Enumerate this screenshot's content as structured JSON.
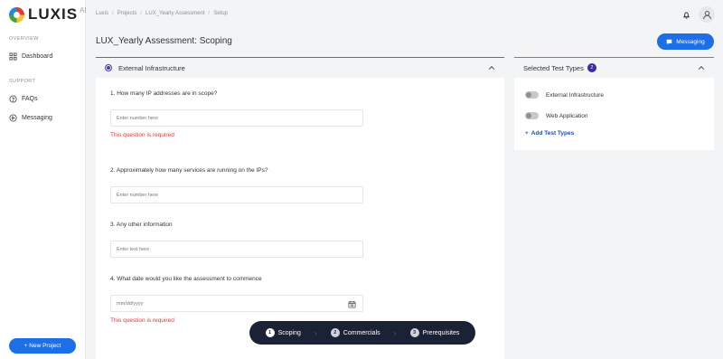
{
  "logo": {
    "text": "LUXIS",
    "suffix": "AI"
  },
  "sidebar": {
    "overview_label": "OVERVIEW",
    "support_label": "SUPPORT",
    "items": [
      {
        "label": "Dashboard",
        "icon": "grid-icon"
      },
      {
        "label": "FAQs",
        "icon": "help-circle-icon"
      },
      {
        "label": "Messaging",
        "icon": "message-circle-icon"
      }
    ],
    "new_project_label": "+ New Project"
  },
  "header": {
    "breadcrumb": [
      "Luxis",
      "Projects",
      "LUX_Yearly Assessment",
      "Setup"
    ],
    "title": "LUX_Yearly Assessment: Scoping",
    "messaging_label": "Messaging"
  },
  "main": {
    "section_title": "External Infrastructure",
    "questions": [
      {
        "label": "1. How many IP addresses are in scope?",
        "placeholder": "Enter number here",
        "error": "This question is required"
      },
      {
        "label": "2. Approximately how many services are running on the IPs?",
        "placeholder": "Enter number here"
      },
      {
        "label": "3. Any other information",
        "placeholder": "Enter text here"
      },
      {
        "label": "4. What date would you like the assessment to commence",
        "placeholder": "mm/dd/yyyy",
        "error": "This question is required"
      }
    ]
  },
  "right_panel": {
    "title": "Selected Test Types",
    "count": "2",
    "types": [
      "External Infrastructure",
      "Web Application"
    ],
    "add_label": "Add Test Types"
  },
  "stepper": {
    "steps": [
      {
        "num": "1",
        "label": "Scoping"
      },
      {
        "num": "2",
        "label": "Commercials"
      },
      {
        "num": "3",
        "label": "Prerequisites"
      }
    ]
  },
  "colors": {
    "primary": "#1d6fe8",
    "sidebar_bg": "#ffffff",
    "error": "#e53935",
    "stepper_bg": "#1c2235"
  }
}
